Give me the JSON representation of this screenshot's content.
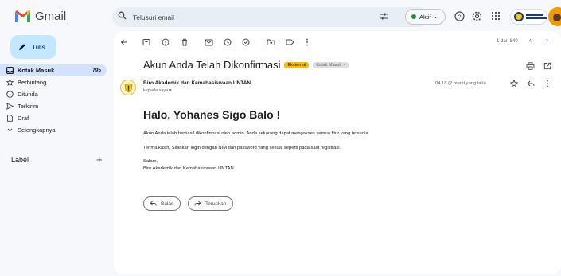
{
  "app": {
    "name": "Gmail"
  },
  "search": {
    "placeholder": "Telusuri email"
  },
  "status": {
    "label": "Aktif"
  },
  "sidebar": {
    "compose_label": "Tulis",
    "items": [
      {
        "label": "Kotak Masuk",
        "count": "795",
        "icon": "inbox-icon"
      },
      {
        "label": "Berbintang",
        "icon": "star-icon"
      },
      {
        "label": "Ditunda",
        "icon": "clock-icon"
      },
      {
        "label": "Terkirim",
        "icon": "send-icon"
      },
      {
        "label": "Draf",
        "icon": "draft-icon"
      },
      {
        "label": "Selengkapnya",
        "icon": "chevron-down-icon"
      }
    ],
    "label_heading": "Label",
    "label_add": "+"
  },
  "message_list": {
    "pager": "1 dari 840"
  },
  "email": {
    "subject": "Akun Anda Telah Dikonfirmasi",
    "chips": {
      "external": "Eksternal",
      "inbox": "Kotak Masuk",
      "inbox_close": "×"
    },
    "sender": "Biro Akademik dan Kemahasiswaan UNTAN",
    "to_line": "kepada saya ▾",
    "time": "04.18 (2 menit yang lalu)",
    "greeting": "Halo, Yohanes Sigo Balo !",
    "body": [
      "Akun Anda telah berhasil dikonfirmasi oleh admin. Anda sekarang dapat mengakses semua fitur yang tersedia.",
      "Terima kasih, Silahkan login dengan NIM dan password yang sesuai seperti pada saat registrasi.",
      "Salam,",
      "Biro Akademik dan Kemahasiswaan UNTAN."
    ],
    "reply_label": "Balas",
    "forward_label": "Teruskan"
  },
  "colors": {
    "accent": "#c2e7ff",
    "active_nav": "#d3e3fd",
    "external_chip": "#fbbc04",
    "status_dot": "#1e8e3e"
  }
}
